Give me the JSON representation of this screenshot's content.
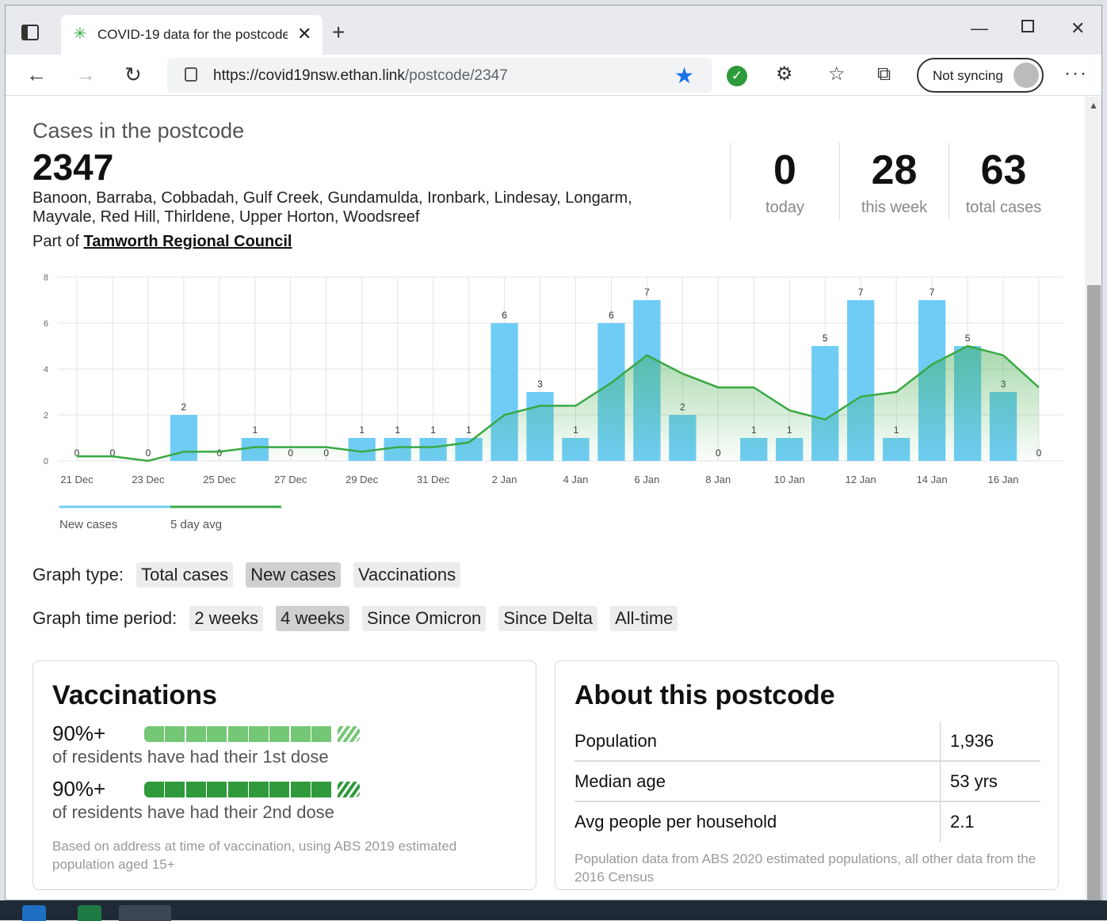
{
  "browser": {
    "tab_title": "COVID-19 data for the postcode",
    "url_host": "https://covid19nsw.ethan.link",
    "url_path": "/postcode/2347",
    "sync_label": "Not syncing"
  },
  "page": {
    "heading": "Cases in the postcode",
    "postcode": "2347",
    "suburbs": "Banoon, Barraba, Cobbadah, Gulf Creek, Gundamulda, Ironbark, Lindesay, Longarm, Mayvale, Red Hill, Thirldene, Upper Horton, Woodsreef",
    "council_prefix": "Part of ",
    "council_name": "Tamworth Regional Council",
    "stats": [
      {
        "value": "0",
        "label": "today"
      },
      {
        "value": "28",
        "label": "this week"
      },
      {
        "value": "63",
        "label": "total cases"
      }
    ]
  },
  "chart_data": {
    "type": "bar",
    "categories": [
      "21 Dec",
      "22 Dec",
      "23 Dec",
      "24 Dec",
      "25 Dec",
      "26 Dec",
      "27 Dec",
      "28 Dec",
      "29 Dec",
      "30 Dec",
      "31 Dec",
      "1 Jan",
      "2 Jan",
      "3 Jan",
      "4 Jan",
      "5 Jan",
      "6 Jan",
      "7 Jan",
      "8 Jan",
      "9 Jan",
      "10 Jan",
      "11 Jan",
      "12 Jan",
      "13 Jan",
      "14 Jan",
      "15 Jan",
      "16 Jan",
      "17 Jan"
    ],
    "x_tick_labels": [
      "21 Dec",
      "23 Dec",
      "25 Dec",
      "27 Dec",
      "29 Dec",
      "31 Dec",
      "2 Jan",
      "4 Jan",
      "6 Jan",
      "8 Jan",
      "10 Jan",
      "12 Jan",
      "14 Jan",
      "16 Jan"
    ],
    "series": [
      {
        "name": "New cases",
        "type": "bar",
        "color": "#6fcdf5",
        "values": [
          0,
          0,
          0,
          2,
          0,
          1,
          0,
          0,
          1,
          1,
          1,
          1,
          6,
          3,
          1,
          6,
          7,
          2,
          0,
          1,
          1,
          5,
          7,
          1,
          7,
          5,
          3,
          0
        ]
      },
      {
        "name": "5 day avg",
        "type": "line",
        "color": "#3aa845",
        "values": [
          0.2,
          0.2,
          0,
          0.4,
          0.4,
          0.6,
          0.6,
          0.6,
          0.4,
          0.6,
          0.6,
          0.8,
          2.0,
          2.4,
          2.4,
          3.4,
          4.6,
          3.8,
          3.2,
          3.2,
          2.2,
          1.8,
          2.8,
          3.0,
          4.2,
          5.0,
          4.6,
          3.2
        ]
      }
    ],
    "y_ticks": [
      0,
      2,
      4,
      6,
      8
    ],
    "ylim": [
      0,
      8
    ],
    "grid": true,
    "legend_position": "bottom-left"
  },
  "controls": {
    "graph_type_label": "Graph type:",
    "graph_types": [
      "Total cases",
      "New cases",
      "Vaccinations"
    ],
    "graph_type_active": "New cases",
    "period_label": "Graph time period:",
    "periods": [
      "2 weeks",
      "4 weeks",
      "Since Omicron",
      "Since Delta",
      "All-time"
    ],
    "period_active": "4 weeks"
  },
  "vaccinations": {
    "title": "Vaccinations",
    "dose1_pct": "90%+",
    "dose1_text": "of residents have had their 1st dose",
    "dose1_level": 0.9,
    "dose1_color": "#74c774",
    "dose2_pct": "90%+",
    "dose2_text": "of residents have had their 2nd dose",
    "dose2_level": 0.9,
    "dose2_color": "#2e9a3b",
    "footnote": "Based on address at time of vaccination, using ABS 2019 estimated population aged 15+"
  },
  "about": {
    "title": "About this postcode",
    "rows": [
      {
        "key": "Population",
        "value": "1,936"
      },
      {
        "key": "Median age",
        "value": "53 yrs"
      },
      {
        "key": "Avg people per household",
        "value": "2.1"
      }
    ],
    "footnote": "Population data from ABS 2020 estimated populations, all other data from the 2016 Census"
  }
}
